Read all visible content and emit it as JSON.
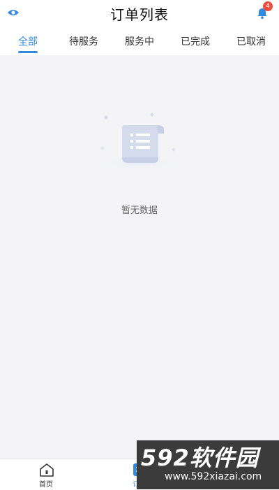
{
  "header": {
    "title": "订单列表",
    "notification_count": "4"
  },
  "tabs": [
    {
      "label": "全部",
      "active": true
    },
    {
      "label": "待服务",
      "active": false
    },
    {
      "label": "服务中",
      "active": false
    },
    {
      "label": "已完成",
      "active": false
    },
    {
      "label": "已取消",
      "active": false
    }
  ],
  "empty_state": {
    "message": "暂无数据",
    "icon": "empty-document-icon"
  },
  "tabbar": {
    "items": [
      {
        "label": "首页",
        "icon": "home-icon"
      },
      {
        "label": "订单",
        "icon": "order-list-icon"
      }
    ]
  },
  "watermark": {
    "text": "592软件园",
    "url": "www.592xiazai.com"
  },
  "colors": {
    "accent": "#2f8ae0",
    "badge": "#ef4d3c",
    "background": "#f4f4f6"
  }
}
